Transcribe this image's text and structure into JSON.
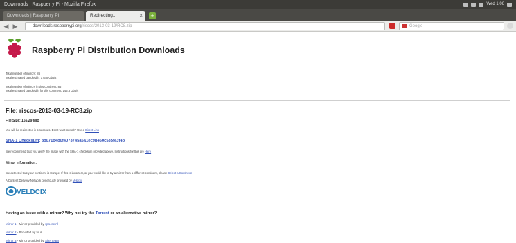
{
  "window": {
    "title": "Downloads | Raspberry Pi - Mozilla Firefox",
    "tray_time": "Wed 1:06"
  },
  "tabs": [
    {
      "label": "Downloads | Raspberry Pi"
    },
    {
      "label": "Redirecting..."
    }
  ],
  "navbar": {
    "url_host": "downloads.raspberrypi.org",
    "url_rest": "/riscos/2013-03-19/RC8.zip",
    "search_placeholder": "Google"
  },
  "page": {
    "title": "Raspberry Pi Distribution Downloads",
    "stats": {
      "mirrors": "Total number of mirrors: 86",
      "bandwidth": "Total estimated bandwidth: 173.0 Gbit/s",
      "continent_mirrors": "Total number of mirrors in this continent: 86",
      "continent_bandwidth": "Total estimated bandwidth for this continent: 145.3 Gbit/s"
    },
    "file_title": "File: riscos-2013-03-19-RC8.zip",
    "file_size": "File Size: 165.29 MiB",
    "redirect_text": "You will be redirected in 5 seconds. Don't want to wait? Use a",
    "redirect_link": "Direct Link",
    "checksum_label": "SHA-1 Checksum",
    "checksum_value": ": 8d071b4d0f4073745a5a1ec9b460c535fe3f4b",
    "verify_text": "We recommend that you verify the image with the SHA-1 checksum provided above. Instructions for this are",
    "verify_link": "Here",
    "mirror_info": "Mirror information:",
    "detected_text": "We detected that your continent is Europe. If this is incorrect, or you would like to try a mirror from a different continent, please",
    "detected_link": "Select a Continent",
    "cdn_text": "A Content Delivery Network generously provided by",
    "cdn_link": "Veldcix",
    "veldcix_logo": "VELDCIX",
    "issue_prefix": "Having an issue with a mirror? Why not try the",
    "issue_link": "Torrent",
    "issue_suffix": "or an alternative mirror?",
    "mirrors": [
      {
        "link": "Mirror 1",
        "text": "- Mirror provided by",
        "provider": "vps.tsc.nl"
      },
      {
        "link": "Mirror 2",
        "text": "- Provided by four",
        "provider": ""
      },
      {
        "link": "Mirror 3",
        "text": "- Mirror provided by",
        "provider": "Site Team"
      }
    ]
  }
}
